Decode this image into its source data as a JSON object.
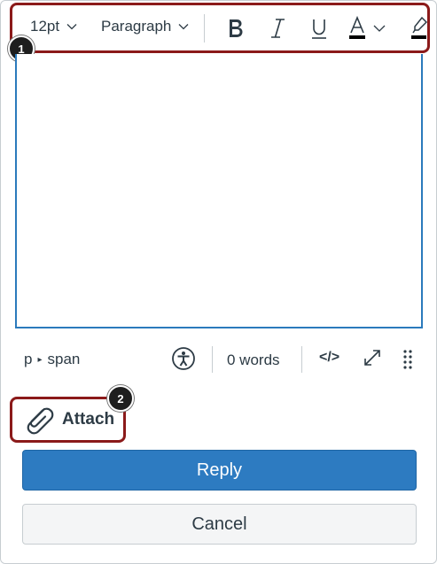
{
  "toolbar": {
    "font_size": "12pt",
    "block_format": "Paragraph",
    "icons": [
      "bold-icon",
      "italic-icon",
      "underline-icon",
      "text-color-icon",
      "chevron-down-icon",
      "highlight-icon"
    ]
  },
  "callouts": {
    "one": "1",
    "two": "2"
  },
  "statusbar": {
    "path_p": "p",
    "path_span": "span",
    "word_count": "0 words",
    "html_toggle": "</>",
    "icons": [
      "accessibility-icon",
      "fullscreen-icon",
      "resize-grip-icon"
    ]
  },
  "attach": {
    "label": "Attach",
    "icon": "paperclip-icon"
  },
  "actions": {
    "reply": "Reply",
    "cancel": "Cancel"
  },
  "colors": {
    "highlight_border": "#8b1a1a",
    "primary": "#2d7bc1",
    "editor_focus": "#2b7abc",
    "text": "#2d3b45"
  }
}
